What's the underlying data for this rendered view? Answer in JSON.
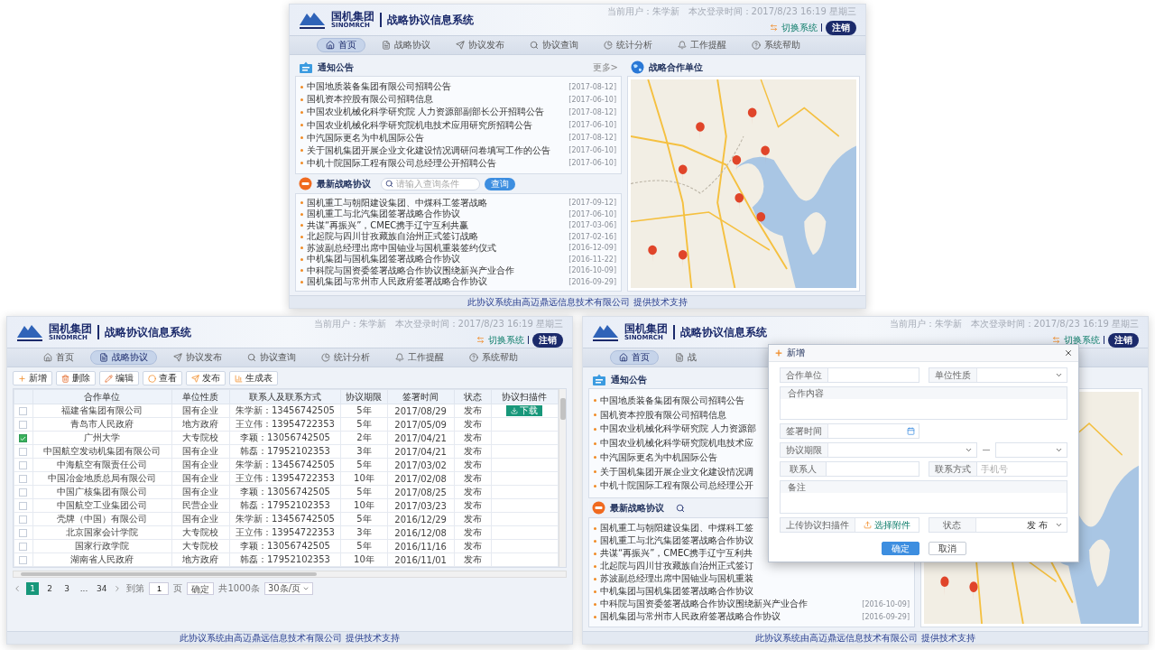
{
  "screens": [
    {
      "kind": "home",
      "header": {
        "logo_cn": "国机集团",
        "logo_en": "SINOMRCH",
        "system": "战略协议信息系统",
        "user": "当前用户：朱学新",
        "login_time": "本次登录时间：2017/8/23 16:19 星期三",
        "switch": "切换系统",
        "logout": "注销"
      },
      "nav": [
        {
          "label": "首页",
          "selected": true
        },
        {
          "label": "战略协议",
          "selected": false
        },
        {
          "label": "协议发布",
          "selected": false
        },
        {
          "label": "协议查询",
          "selected": false
        },
        {
          "label": "统计分析",
          "selected": false
        },
        {
          "label": "工作提醒",
          "selected": false
        },
        {
          "label": "系统帮助",
          "selected": false
        }
      ],
      "notices": {
        "title": "通知公告",
        "more": "更多>",
        "items": [
          {
            "text": "中国地质装备集团有限公司招聘公告",
            "date": "[2017-08-12]"
          },
          {
            "text": "国机资本控股有限公司招聘信息",
            "date": "[2017-06-10]"
          },
          {
            "text": "中国农业机械化科学研究院 人力资源部副部长公开招聘公告",
            "date": "[2017-08-12]"
          },
          {
            "text": "中国农业机械化科学研究院机电技术应用研究所招聘公告",
            "date": "[2017-06-10]"
          },
          {
            "text": "中汽国际更名为中机国际公告",
            "date": "[2017-08-12]"
          },
          {
            "text": "关于国机集团开展企业文化建设情况调研问卷填写工作的公告",
            "date": "[2017-06-10]"
          },
          {
            "text": "中机十院国际工程有限公司总经理公开招聘公告",
            "date": "[2017-06-10]"
          }
        ]
      },
      "agreements": {
        "title": "最新战略协议",
        "search": {
          "placeholder": "请输入查询条件",
          "button": "查询"
        },
        "items": [
          {
            "text": "国机重工与朝阳建设集团、中煤科工签署战略",
            "date": "[2017-09-12]"
          },
          {
            "text": "国机重工与北汽集团签署战略合作协议",
            "date": "[2017-06-10]"
          },
          {
            "text": "共谋“再振兴”，CMEC携手辽宁互利共赢",
            "date": "[2017-03-06]"
          },
          {
            "text": "北起院与四川甘孜藏族自治州正式签订战略",
            "date": "[2017-02-16]"
          },
          {
            "text": "苏波副总经理出席中国铀业与国机重装签约仪式",
            "date": "[2016-12-09]"
          },
          {
            "text": "中机集团与国机集团签署战略合作协议",
            "date": "[2016-11-22]"
          },
          {
            "text": "中科院与国资委签署战略合作协议围绕新兴产业合作",
            "date": "[2016-10-09]"
          },
          {
            "text": "国机集团与常州市人民政府签署战略合作协议",
            "date": "[2016-09-29]"
          }
        ]
      },
      "map": {
        "title": "战略合作单位",
        "kind": "picture"
      },
      "footer": "此协议系统由高迈鼎远信息技术有限公司 提供技术支持"
    },
    {
      "kind": "table",
      "header": {
        "logo_cn": "国机集团",
        "logo_en": "SINOMRCH",
        "system": "战略协议信息系统",
        "user": "当前用户：朱学新",
        "login_time": "本次登录时间：2017/8/23 16:19 星期三",
        "switch": "切换系统",
        "logout": "注销"
      },
      "nav": [
        {
          "label": "首页",
          "selected": false
        },
        {
          "label": "战略协议",
          "selected": true
        },
        {
          "label": "协议发布",
          "selected": false
        },
        {
          "label": "协议查询",
          "selected": false
        },
        {
          "label": "统计分析",
          "selected": false
        },
        {
          "label": "工作提醒",
          "selected": false
        },
        {
          "label": "系统帮助",
          "selected": false
        }
      ],
      "toolbar": [
        "新增",
        "删除",
        "编辑",
        "查看",
        "发布",
        "生成表"
      ],
      "table": {
        "columns": [
          "合作单位",
          "单位性质",
          "联系人及联系方式",
          "协议期限",
          "签署时间",
          "状态",
          "协议扫描件"
        ],
        "rows": [
          {
            "checked": false,
            "unit": "福建省集团有限公司",
            "nature": "国有企业",
            "contact": "朱学新：13456742505",
            "term": "5年",
            "date": "2017/08/29",
            "status": "发布",
            "scan": "下载"
          },
          {
            "checked": false,
            "unit": "青岛市人民政府",
            "nature": "地方政府",
            "contact": "王立伟：13954722353",
            "term": "5年",
            "date": "2017/05/09",
            "status": "发布"
          },
          {
            "checked": true,
            "unit": "广州大学",
            "nature": "大专院校",
            "contact": "李颖：13056742505",
            "term": "2年",
            "date": "2017/04/21",
            "status": "发布"
          },
          {
            "checked": false,
            "unit": "中国航空发动机集团有限公司",
            "nature": "国有企业",
            "contact": "韩磊：17952102353",
            "term": "3年",
            "date": "2017/04/21",
            "status": "发布"
          },
          {
            "checked": false,
            "unit": "中海航空有限责任公司",
            "nature": "国有企业",
            "contact": "朱学新：13456742505",
            "term": "5年",
            "date": "2017/03/02",
            "status": "发布"
          },
          {
            "checked": false,
            "unit": "中国冶金地质总局有限公司",
            "nature": "国有企业",
            "contact": "王立伟：13954722353",
            "term": "10年",
            "date": "2017/02/08",
            "status": "发布"
          },
          {
            "checked": false,
            "unit": "中国广核集团有限公司",
            "nature": "国有企业",
            "contact": "李颖：13056742505",
            "term": "5年",
            "date": "2017/08/25",
            "status": "发布"
          },
          {
            "checked": false,
            "unit": "中国航空工业集团公司",
            "nature": "民营企业",
            "contact": "韩磊：17952102353",
            "term": "10年",
            "date": "2017/03/23",
            "status": "发布"
          },
          {
            "checked": false,
            "unit": "壳牌（中国）有限公司",
            "nature": "国有企业",
            "contact": "朱学新：13456742505",
            "term": "5年",
            "date": "2016/12/29",
            "status": "发布"
          },
          {
            "checked": false,
            "unit": "北京国家会计学院",
            "nature": "大专院校",
            "contact": "王立伟：13954722353",
            "term": "3年",
            "date": "2016/12/08",
            "status": "发布"
          },
          {
            "checked": false,
            "unit": "国家行政学院",
            "nature": "大专院校",
            "contact": "李颖：13056742505",
            "term": "5年",
            "date": "2016/11/16",
            "status": "发布"
          },
          {
            "checked": false,
            "unit": "湖南省人民政府",
            "nature": "地方政府",
            "contact": "韩磊：17952102353",
            "term": "10年",
            "date": "2016/11/01",
            "status": "发布"
          }
        ]
      },
      "pagination": {
        "pages": [
          {
            "label": "1",
            "selected": true
          },
          {
            "label": "2",
            "selected": false
          },
          {
            "label": "3",
            "selected": false
          },
          {
            "label": "...",
            "selected": false
          },
          {
            "label": "34",
            "selected": false
          }
        ],
        "goto_label": "到第",
        "goto_value": "1",
        "page_unit": "页",
        "goto_button": "确定",
        "total": "共1000条",
        "page_size": "30条/页"
      },
      "footer": "此协议系统由高迈鼎远信息技术有限公司 提供技术支持"
    },
    {
      "kind": "home",
      "header": {
        "logo_cn": "国机集团",
        "logo_en": "SINOMRCH",
        "system": "战略协议信息系统",
        "user": "当前用户：朱学新",
        "login_time": "本次登录时间：2017/8/23 16:19 星期三",
        "switch": "切换系统",
        "logout": "注销"
      },
      "nav": [
        {
          "label": "首页",
          "selected": true
        },
        {
          "label": "战",
          "selected": false
        }
      ],
      "notices": {
        "title": "通知公告",
        "items": [
          {
            "text": "中国地质装备集团有限公司招聘公告"
          },
          {
            "text": "国机资本控股有限公司招聘信息"
          },
          {
            "text": "中国农业机械化科学研究院 人力资源部"
          },
          {
            "text": "中国农业机械化科学研究院机电技术应"
          },
          {
            "text": "中汽国际更名为中机国际公告"
          },
          {
            "text": "关于国机集团开展企业文化建设情况调"
          },
          {
            "text": "中机十院国际工程有限公司总经理公开"
          }
        ]
      },
      "agreements": {
        "title": "最新战略协议",
        "items": [
          {
            "text": "国机重工与朝阳建设集团、中煤科工签"
          },
          {
            "text": "国机重工与北汽集团签署战略合作协议"
          },
          {
            "text": "共谋“再振兴”，CMEC携手辽宁互利共"
          },
          {
            "text": "北起院与四川甘孜藏族自治州正式签订"
          },
          {
            "text": "苏波副总经理出席中国铀业与国机重装"
          },
          {
            "text": "中机集团与国机集团签署战略合作协议"
          },
          {
            "text": "中科院与国资委签署战略合作协议围绕新兴产业合作",
            "date": "[2016-10-09]"
          },
          {
            "text": "国机集团与常州市人民政府签署战略合作协议",
            "date": "[2016-09-29]"
          }
        ]
      },
      "map": {
        "kind": "picture"
      },
      "dialog": {
        "title": "新增",
        "fields": [
          {
            "kind": "input",
            "label": "合作单位"
          },
          {
            "kind": "select",
            "label": "单位性质"
          },
          {
            "kind": "textarea",
            "label": "合作内容"
          },
          {
            "kind": "date",
            "label": "签署时间"
          },
          {
            "kind": "range",
            "label": "协议期限"
          },
          {
            "kind": "input",
            "label": "联系人"
          },
          {
            "kind": "input",
            "label": "联系方式",
            "placeholder": "手机号"
          },
          {
            "kind": "textarea",
            "label": "备注"
          },
          {
            "kind": "file",
            "label": "上传协议扫描件",
            "button": "选择附件"
          },
          {
            "kind": "select",
            "label": "状态",
            "value": "发 布"
          }
        ],
        "buttons": [
          {
            "label": "确定",
            "primary": true
          },
          {
            "label": "取消",
            "primary": false
          }
        ]
      },
      "footer": "此协议系统由高迈鼎远信息技术有限公司 提供技术支持"
    }
  ]
}
